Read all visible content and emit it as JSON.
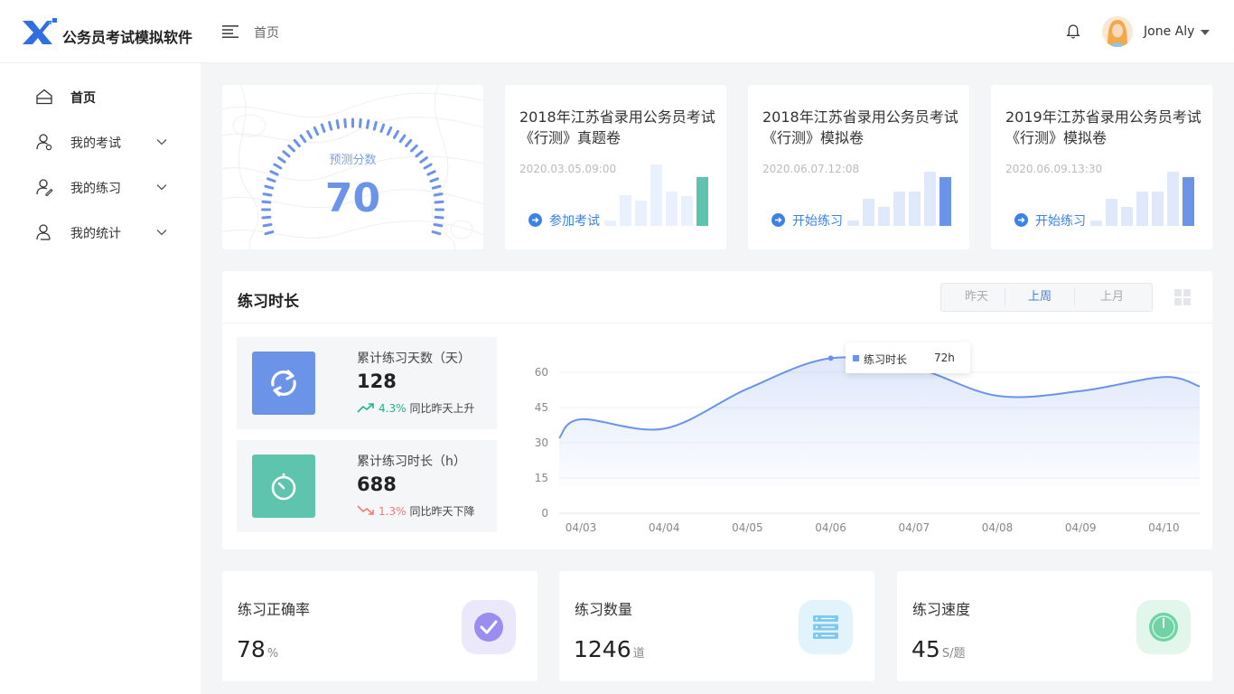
{
  "app": {
    "title": "公务员考试模拟软件"
  },
  "header": {
    "breadcrumb": "首页",
    "user_name": "Jone Aly"
  },
  "sidebar": {
    "items": [
      {
        "label": "首页",
        "icon": "home-icon",
        "active": true
      },
      {
        "label": "我的考试",
        "icon": "user-exam-icon",
        "expandable": true
      },
      {
        "label": "我的练习",
        "icon": "user-practice-icon",
        "expandable": true
      },
      {
        "label": "我的统计",
        "icon": "user-stats-icon",
        "expandable": true
      }
    ]
  },
  "score": {
    "label": "预测分数",
    "value": "70"
  },
  "exams": [
    {
      "title_line1": "2018年江苏省录用公务员考试",
      "title_line2": "《行测》真题卷",
      "date": "2020.03.05.09:00",
      "action": "参加考试",
      "accent": "#5ec4ad"
    },
    {
      "title_line1": "2018年江苏省录用公务员考试",
      "title_line2": "《行测》模拟卷",
      "date": "2020.06.07.12:08",
      "action": "开始练习",
      "accent": "#6b94e8"
    },
    {
      "title_line1": "2019年江苏省录用公务员考试",
      "title_line2": "《行测》模拟卷",
      "date": "2020.06.09.13:30",
      "action": "开始练习",
      "accent": "#6b94e8"
    }
  ],
  "duration": {
    "title": "练习时长",
    "tabs": [
      {
        "label": "昨天",
        "active": false
      },
      {
        "label": "上周",
        "active": true
      },
      {
        "label": "上月",
        "active": false
      }
    ],
    "stats": [
      {
        "label": "累计练习天数（天）",
        "value": "128",
        "trend": "4.3%",
        "trend_text": "同比昨天上升",
        "direction": "up",
        "color": "#6b94e8"
      },
      {
        "label": "累计练习时长（h）",
        "value": "688",
        "trend": "1.3%",
        "trend_text": "同比昨天下降",
        "direction": "down",
        "color": "#5ec4ad"
      }
    ],
    "tooltip": {
      "name": "练习时长",
      "value": "72h"
    }
  },
  "chart_data": {
    "type": "area",
    "x": [
      "04/03",
      "04/04",
      "04/05",
      "04/06",
      "04/07",
      "04/08",
      "04/09",
      "04/10"
    ],
    "series": [
      {
        "name": "练习时长",
        "values": [
          40,
          36,
          53,
          66,
          62,
          50,
          52,
          58
        ]
      }
    ],
    "y_ticks": [
      0,
      15,
      30,
      45,
      60
    ],
    "ylim": [
      0,
      60
    ],
    "color": "#6b94e8",
    "grid": true,
    "highlight_index": 3
  },
  "metrics": [
    {
      "label": "练习正确率",
      "value": "78",
      "unit": "%",
      "icon": "check-circle-icon",
      "bg": "#ebe8fb",
      "fg": "#9b8cf0"
    },
    {
      "label": "练习数量",
      "value": "1246",
      "unit": "道",
      "icon": "database-icon",
      "bg": "#e3f3fb",
      "fg": "#7fc9ee"
    },
    {
      "label": "练习速度",
      "value": "45",
      "unit": "S/题",
      "icon": "speedometer-icon",
      "bg": "#e2f6ec",
      "fg": "#6fd3a5"
    }
  ]
}
